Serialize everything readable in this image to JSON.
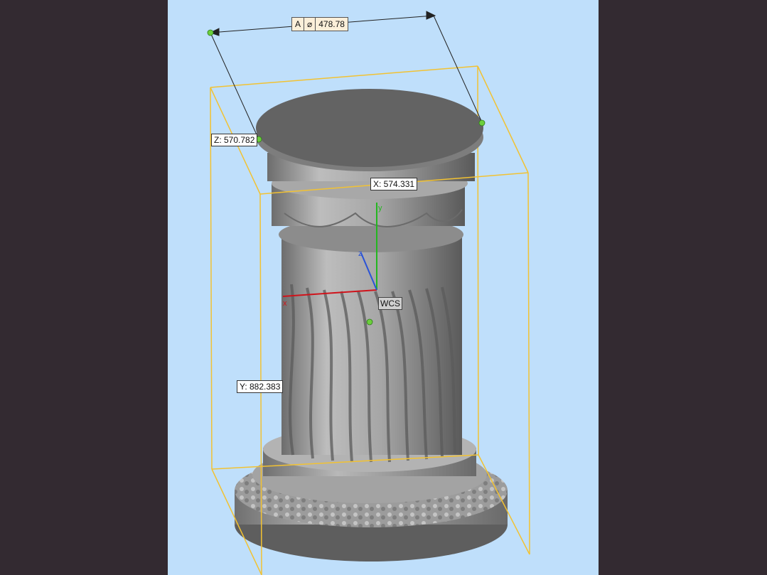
{
  "dimension_label": {
    "letter": "A",
    "symbol": "⌀",
    "value": "478.78"
  },
  "measurements": {
    "x": "X: 574.331",
    "y": "Y: 882.383",
    "z": "Z: 570.782"
  },
  "axes": {
    "x_label": "x",
    "y_label": "y",
    "z_label": "z"
  },
  "wcs_label": "WCS",
  "colors": {
    "viewport_background": "#bfdffb",
    "outer_background": "#332a31",
    "bounding_box": "#f2c232",
    "axis_x": "#d0131b",
    "axis_y": "#23b71f",
    "axis_z": "#2a53d6",
    "measure_point": "#6ccf3c",
    "model": "#9a9a9a"
  }
}
